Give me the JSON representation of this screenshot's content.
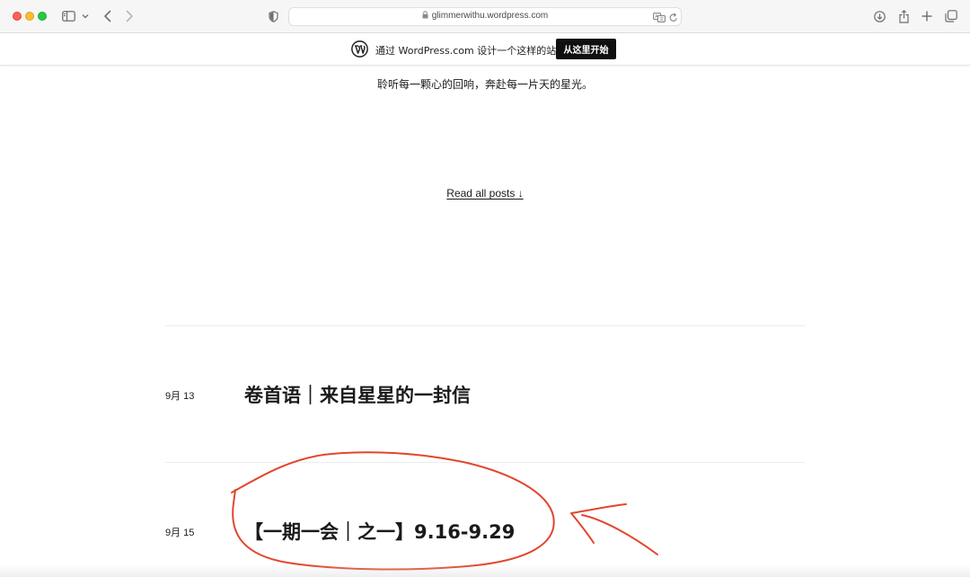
{
  "browser": {
    "url": "glimmerwithu.wordpress.com"
  },
  "banner": {
    "text": "通过 WordPress.com 设计一个这样的站点",
    "button_label": "从这里开始"
  },
  "site": {
    "tagline": "聆听每一颗心的回响，奔赴每一片天的星光。",
    "read_all_label": "Read all posts",
    "read_all_arrow": "↓"
  },
  "posts": [
    {
      "date": "9月 13",
      "title": "卷首语｜来自星星的一封信"
    },
    {
      "date": "9月 15",
      "title": "【一期一会｜之一】9.16-9.29"
    }
  ],
  "colors": {
    "annotation": "#e2462c",
    "wp_button_bg": "#101010"
  },
  "icons": [
    "sidebar-icon",
    "chevron-down-icon",
    "back-icon",
    "forward-icon",
    "privacy-shield-icon",
    "lock-icon",
    "translate-icon",
    "reload-icon",
    "download-icon",
    "share-icon",
    "new-tab-icon",
    "tab-overview-icon",
    "wordpress-logo-icon"
  ]
}
